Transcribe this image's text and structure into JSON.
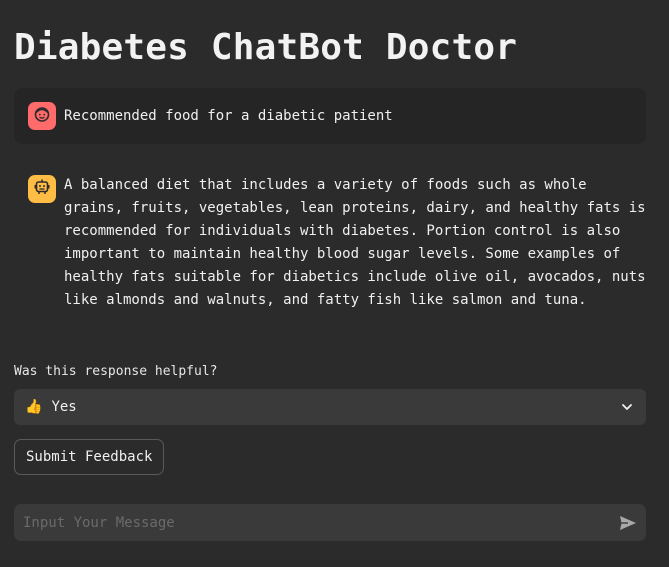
{
  "app": {
    "title": "Diabetes ChatBot Doctor"
  },
  "messages": [
    {
      "role": "user",
      "avatar_icon": "user-face-icon",
      "avatar_color": "#ff6b6b",
      "text": "Recommended food for a diabetic patient"
    },
    {
      "role": "assistant",
      "avatar_icon": "bot-icon",
      "avatar_color": "#ffbd45",
      "text": "A balanced diet that includes a variety of foods such as whole grains, fruits, vegetables, lean proteins, dairy, and healthy fats is recommended for individuals with diabetes. Portion control is also important to maintain healthy blood sugar levels. Some examples of healthy fats suitable for diabetics include olive oil, avocados, nuts like almonds and walnuts, and fatty fish like salmon and tuna."
    }
  ],
  "feedback": {
    "label": "Was this response helpful?",
    "selected_icon": "👍",
    "selected_value": "Yes",
    "dropdown_icon": "chevron-down-icon",
    "submit_label": "Submit Feedback"
  },
  "chat_input": {
    "placeholder": "Input Your Message",
    "value": "",
    "send_icon": "send-icon"
  },
  "colors": {
    "background": "#2b2b2b",
    "user_message_bg": "#252525",
    "input_bg": "#3a3a3a"
  }
}
